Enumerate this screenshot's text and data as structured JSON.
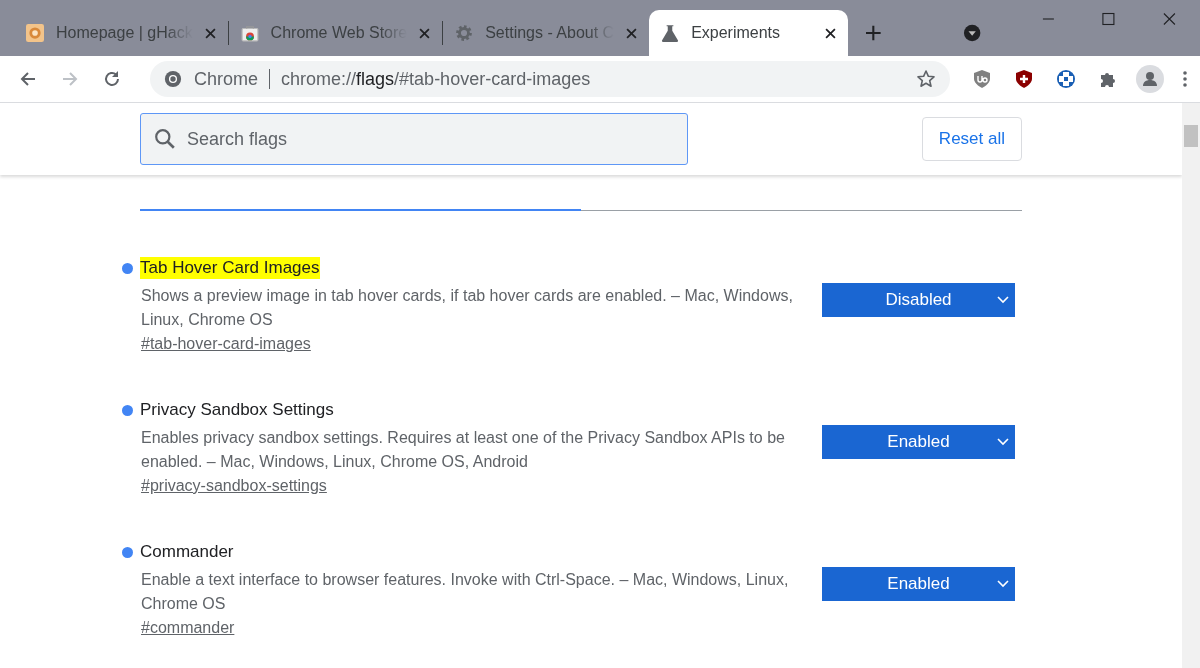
{
  "tabs": [
    {
      "title": "Homepage | gHack",
      "selected": false
    },
    {
      "title": "Chrome Web Store",
      "selected": false
    },
    {
      "title": "Settings - About C",
      "selected": false
    },
    {
      "title": "Experiments",
      "selected": true
    }
  ],
  "omnibox": {
    "site": "Chrome",
    "url_prefix": "chrome://",
    "url_bold": "flags",
    "url_rest": "/#tab-hover-card-images"
  },
  "search": {
    "placeholder": "Search flags"
  },
  "reset_button": "Reset all",
  "view_tabs": [
    {
      "selected": true
    },
    {
      "selected": false
    }
  ],
  "flags": [
    {
      "title": "Tab Hover Card Images",
      "highlighted": true,
      "description": "Shows a preview image in tab hover cards, if tab hover cards are enabled. – Mac, Windows, Linux, Chrome OS",
      "link": "#tab-hover-card-images",
      "value": "Disabled"
    },
    {
      "title": "Privacy Sandbox Settings",
      "highlighted": false,
      "description": "Enables privacy sandbox settings. Requires at least one of the Privacy Sandbox APIs to be enabled. – Mac, Windows, Linux, Chrome OS, Android",
      "link": "#privacy-sandbox-settings",
      "value": "Enabled"
    },
    {
      "title": "Commander",
      "highlighted": false,
      "description": "Enable a text interface to browser features. Invoke with Ctrl-Space. – Mac, Windows, Linux, Chrome OS",
      "link": "#commander",
      "value": "Enabled"
    }
  ]
}
